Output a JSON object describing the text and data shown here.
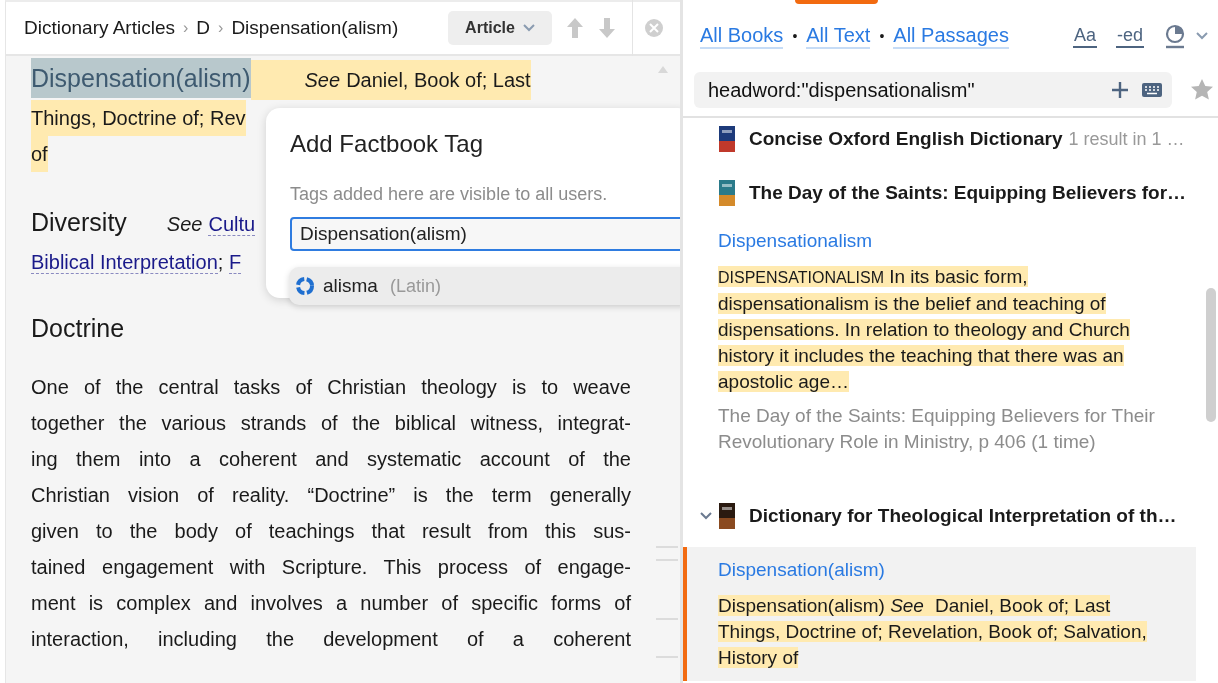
{
  "breadcrumb": {
    "items": [
      "Dictionary Articles",
      "D",
      "Dispensation(alism)"
    ],
    "separator": "›"
  },
  "view_button": {
    "label": "Article"
  },
  "article": {
    "entries": [
      {
        "headword": "Dispensation(alism)",
        "selected": true,
        "highlighted": true,
        "lines": [
          [
            {
              "text": "See",
              "kind": "italic"
            },
            {
              "text": "Daniel, Book of; Last",
              "kind": "plain"
            }
          ],
          [
            {
              "text": "Things, Doctrine of; Rev",
              "kind": "plain"
            }
          ],
          [
            {
              "text": "of",
              "kind": "plain"
            }
          ]
        ]
      },
      {
        "headword": "Diversity",
        "selected": false,
        "highlighted": false,
        "lines": [
          [
            {
              "text": "See",
              "kind": "italic"
            },
            {
              "text": "Cultu",
              "kind": "link"
            }
          ],
          [
            {
              "text": "Biblical Interpretation",
              "kind": "link"
            },
            {
              "text": "; ",
              "kind": "plain"
            },
            {
              "text": "F",
              "kind": "link"
            }
          ]
        ]
      }
    ],
    "heading": "Doctrine",
    "paragraph": [
      "One of the central tasks of Christian theology is to weave",
      "together the various strands of the biblical witness, integrat-",
      "ing them into a coherent and systematic account of the",
      "Christian vision of reality. “Doctrine” is the term generally",
      "given to the body of teachings that result from this sus-",
      "tained engagement with Scripture. This process of engage-",
      "ment is complex and involves a number of specific forms of",
      "interaction, including the development of a coherent"
    ]
  },
  "tag_dialog": {
    "title": "Add Factbook Tag",
    "hint": "Tags added here are visible to all users.",
    "value": "Dispensation(alism)",
    "suggestions": [
      {
        "word": "alisma",
        "language": "(Latin)",
        "selected": true
      }
    ]
  },
  "search_panel": {
    "scopes": [
      "All Books",
      "All Text",
      "All Passages"
    ],
    "scope_separator": "•",
    "format_buttons": [
      "Aa",
      "-ed"
    ],
    "search": {
      "value": "headword:\"dispensationalism\""
    },
    "books": [
      {
        "title": "Concise Oxford English Dictionary",
        "meta": "1 result in 1 …"
      },
      {
        "title": "The Day of the Saints: Equipping Believers for…",
        "hits": [
          {
            "headword": "Dispensationalism",
            "selected": false,
            "snippet": [
              {
                "text": "DISPENSATIONALISM",
                "kind": "smallcaps"
              },
              {
                "text": " In its basic form, dispensationalism is the belief and teaching of dispensations. In relation to theology and Church history it includes the teaching that there was an apostolic age…",
                "kind": "plain"
              }
            ],
            "source": "The Day of the Saints: Equipping Believers for Their Revolutionary Role in Ministry, p 406 (1 time)"
          }
        ]
      },
      {
        "title": "Dictionary for Theological Interpretation of th…",
        "expanded": true,
        "hits": [
          {
            "headword": "Dispensation(alism)",
            "selected": true,
            "snippet": [
              {
                "text": "Dispensation(alism) ",
                "kind": "plain"
              },
              {
                "text": "See",
                "kind": "italic"
              },
              {
                "text": " Daniel, Book of; Last Things, Doctrine of; Revelation, Book of; Salvation, History of",
                "kind": "plain"
              }
            ]
          }
        ]
      }
    ]
  }
}
